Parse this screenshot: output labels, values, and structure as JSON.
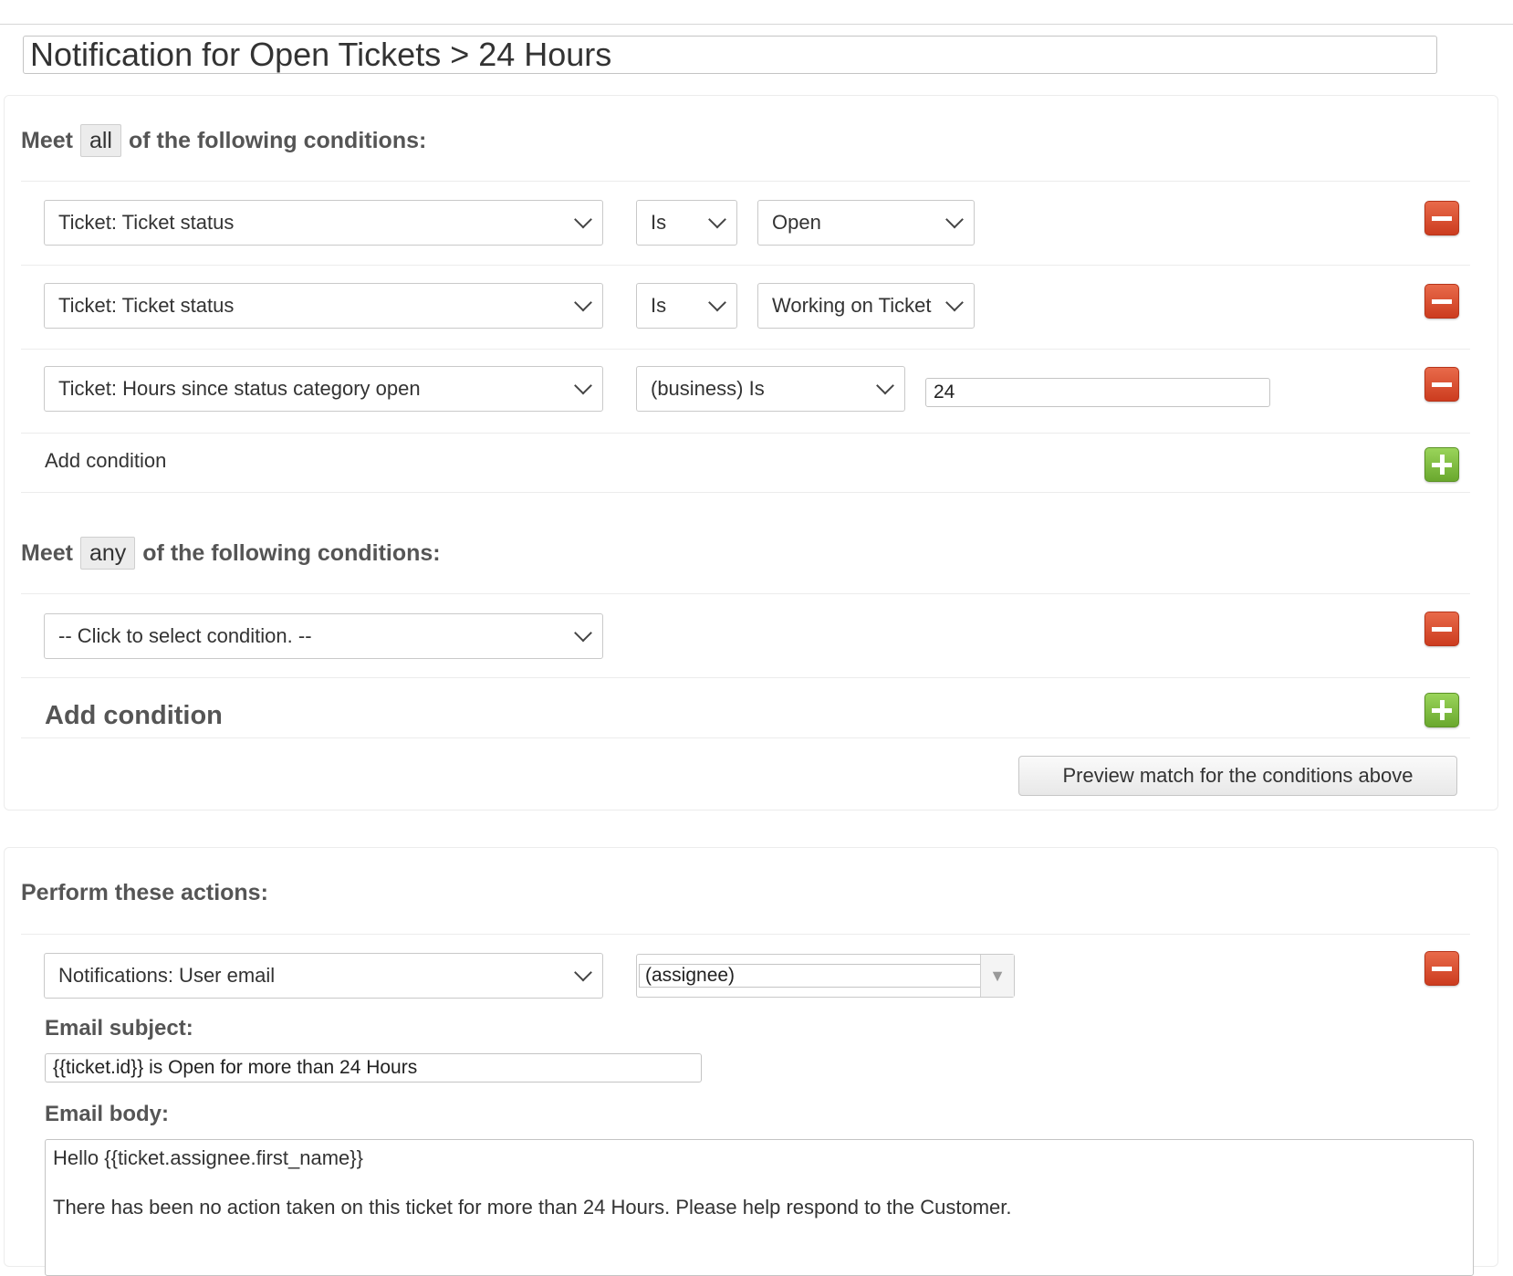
{
  "trigger": {
    "title": "Notification for Open Tickets > 24 Hours"
  },
  "all_conditions": {
    "heading_prefix": "Meet",
    "mode": "all",
    "heading_suffix": "of the following conditions:",
    "rows": [
      {
        "field": "Ticket: Ticket status",
        "operator": "Is",
        "value": "Open"
      },
      {
        "field": "Ticket: Ticket status",
        "operator": "Is",
        "value": "Working on Ticket"
      },
      {
        "field": "Ticket: Hours since status category open",
        "operator": "(business) Is",
        "value": "24"
      }
    ],
    "add_label": "Add condition"
  },
  "any_conditions": {
    "heading_prefix": "Meet",
    "mode": "any",
    "heading_suffix": "of the following conditions:",
    "rows": [
      {
        "field": "-- Click to select condition. --"
      }
    ],
    "add_label": "Add condition",
    "preview_label": "Preview match for the conditions above"
  },
  "actions": {
    "heading": "Perform these actions:",
    "action": {
      "field": "Notifications: User email",
      "recipient": "(assignee)"
    },
    "subject_label": "Email subject:",
    "subject_value": "{{ticket.id}} is Open for more than 24 Hours",
    "body_label": "Email body:",
    "body_value": "Hello {{ticket.assignee.first_name}}\n\nThere has been no action taken on this ticket for more than 24 Hours. Please help respond to the Customer."
  },
  "colors": {
    "remove_button": "#d9482b",
    "add_button": "#7dbb3f"
  },
  "icons": [
    "remove-icon",
    "add-icon",
    "chevron-down-icon",
    "dropdown-arrow-icon"
  ]
}
